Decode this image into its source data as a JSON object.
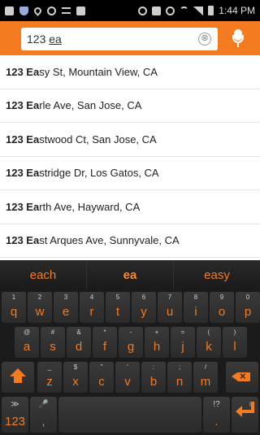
{
  "status_bar": {
    "time": "1:44 PM",
    "icons": [
      "screenshot-icon",
      "shield-icon",
      "location-icon",
      "sync-icon",
      "wifi-icon",
      "media-icon",
      "mute-icon",
      "nfc-icon",
      "alarm-icon",
      "signal-icon",
      "battery-icon"
    ]
  },
  "search": {
    "value_bold": "123 ",
    "value_typed": "ea",
    "clear_symbol": "⊗",
    "accent_color": "#f47b20"
  },
  "suggestions": [
    {
      "match": "123 Ea",
      "rest": "sy St, Mountain View, CA"
    },
    {
      "match": "123 Ea",
      "rest": "rle Ave, San Jose, CA"
    },
    {
      "match": "123 Ea",
      "rest": "stwood Ct, San Jose, CA"
    },
    {
      "match": "123 Ea",
      "rest": "stridge Dr, Los Gatos, CA"
    },
    {
      "match": "123 Ea",
      "rest": "rth Ave, Hayward, CA"
    },
    {
      "match": "123 Ea",
      "rest": "st Arques Ave, Sunnyvale, CA"
    }
  ],
  "keyboard": {
    "predictions": [
      "each",
      "ea",
      "easy"
    ],
    "row1": [
      {
        "main": "q",
        "hint": "1"
      },
      {
        "main": "w",
        "hint": "2"
      },
      {
        "main": "e",
        "hint": "3"
      },
      {
        "main": "r",
        "hint": "4"
      },
      {
        "main": "t",
        "hint": "5"
      },
      {
        "main": "y",
        "hint": "6"
      },
      {
        "main": "u",
        "hint": "7"
      },
      {
        "main": "i",
        "hint": "8"
      },
      {
        "main": "o",
        "hint": "9"
      },
      {
        "main": "p",
        "hint": "0"
      }
    ],
    "row2": [
      {
        "main": "a",
        "hint": "@"
      },
      {
        "main": "s",
        "hint": "#"
      },
      {
        "main": "d",
        "hint": "&"
      },
      {
        "main": "f",
        "hint": "*"
      },
      {
        "main": "g",
        "hint": "-"
      },
      {
        "main": "h",
        "hint": "+"
      },
      {
        "main": "j",
        "hint": "="
      },
      {
        "main": "k",
        "hint": "("
      },
      {
        "main": "l",
        "hint": ")"
      }
    ],
    "row3": [
      {
        "main": "z",
        "hint": "_"
      },
      {
        "main": "x",
        "hint": "$"
      },
      {
        "main": "c",
        "hint": "\""
      },
      {
        "main": "v",
        "hint": "'"
      },
      {
        "main": "b",
        "hint": ":"
      },
      {
        "main": "n",
        "hint": ";"
      },
      {
        "main": "m",
        "hint": "/"
      }
    ],
    "symbols_key": "123",
    "symbols_hint": "≫",
    "comma_key": ",",
    "comma_hint": "🎤",
    "period_key": ".",
    "period_hint": "!?",
    "emoji_hint": "☺"
  }
}
